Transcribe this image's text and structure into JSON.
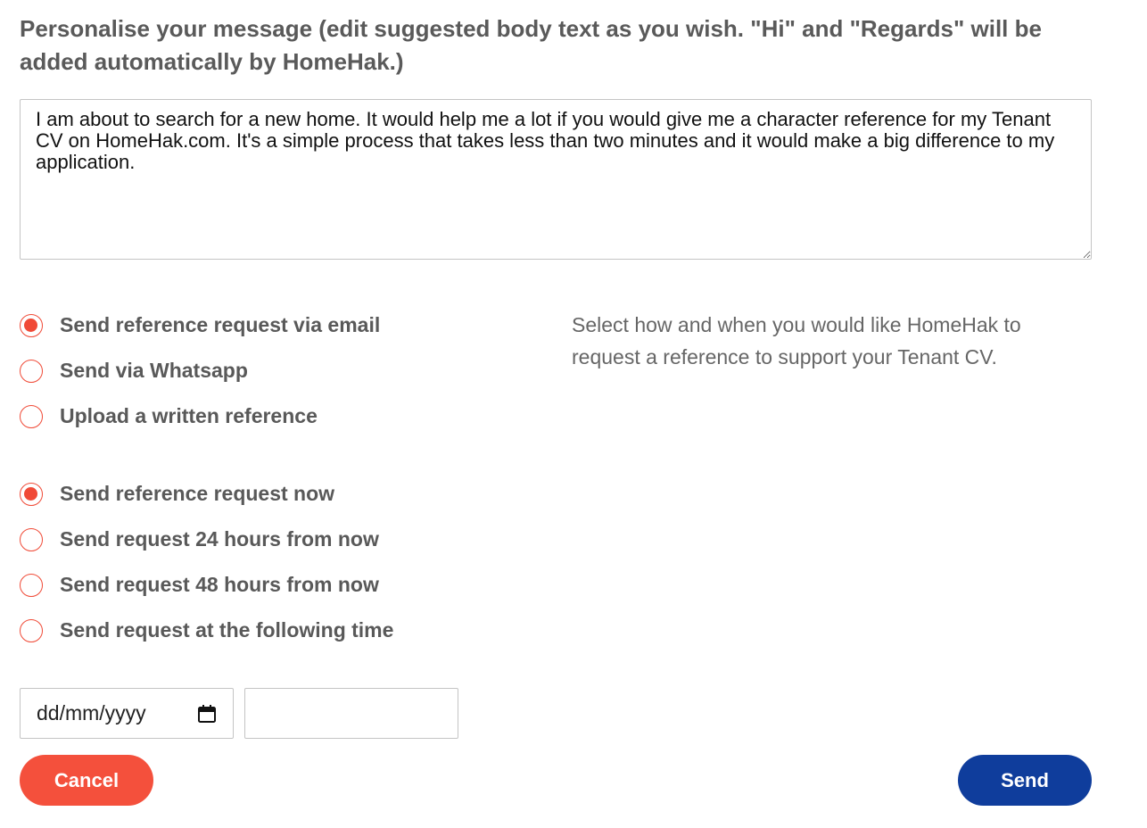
{
  "heading": "Personalise your message (edit suggested body text as you wish. \"Hi\" and \"Regards\" will be added automatically by HomeHak.)",
  "message": "I am about to search for a new home. It would help me a lot if you would give me a character reference for my Tenant CV on HomeHak.com. It's a simple process that takes less than two minutes and it would make a big difference to my application.",
  "method_options": [
    {
      "label": "Send reference request via email",
      "checked": true
    },
    {
      "label": "Send via Whatsapp",
      "checked": false
    },
    {
      "label": "Upload a written reference",
      "checked": false
    }
  ],
  "timing_options": [
    {
      "label": "Send reference request now",
      "checked": true
    },
    {
      "label": "Send request 24 hours from now",
      "checked": false
    },
    {
      "label": "Send request 48 hours from now",
      "checked": false
    },
    {
      "label": "Send request at the following time",
      "checked": false
    }
  ],
  "helper_text": "Select how and when you would like HomeHak to request a reference to support your Tenant CV.",
  "date_input": {
    "placeholder": "dd/mm/yyyy",
    "icon": "calendar-icon"
  },
  "time_input": {
    "value": ""
  },
  "buttons": {
    "cancel": "Cancel",
    "send": "Send"
  },
  "colors": {
    "accent": "#f04a37",
    "cancel": "#f4503c",
    "send": "#0f3d9c"
  }
}
